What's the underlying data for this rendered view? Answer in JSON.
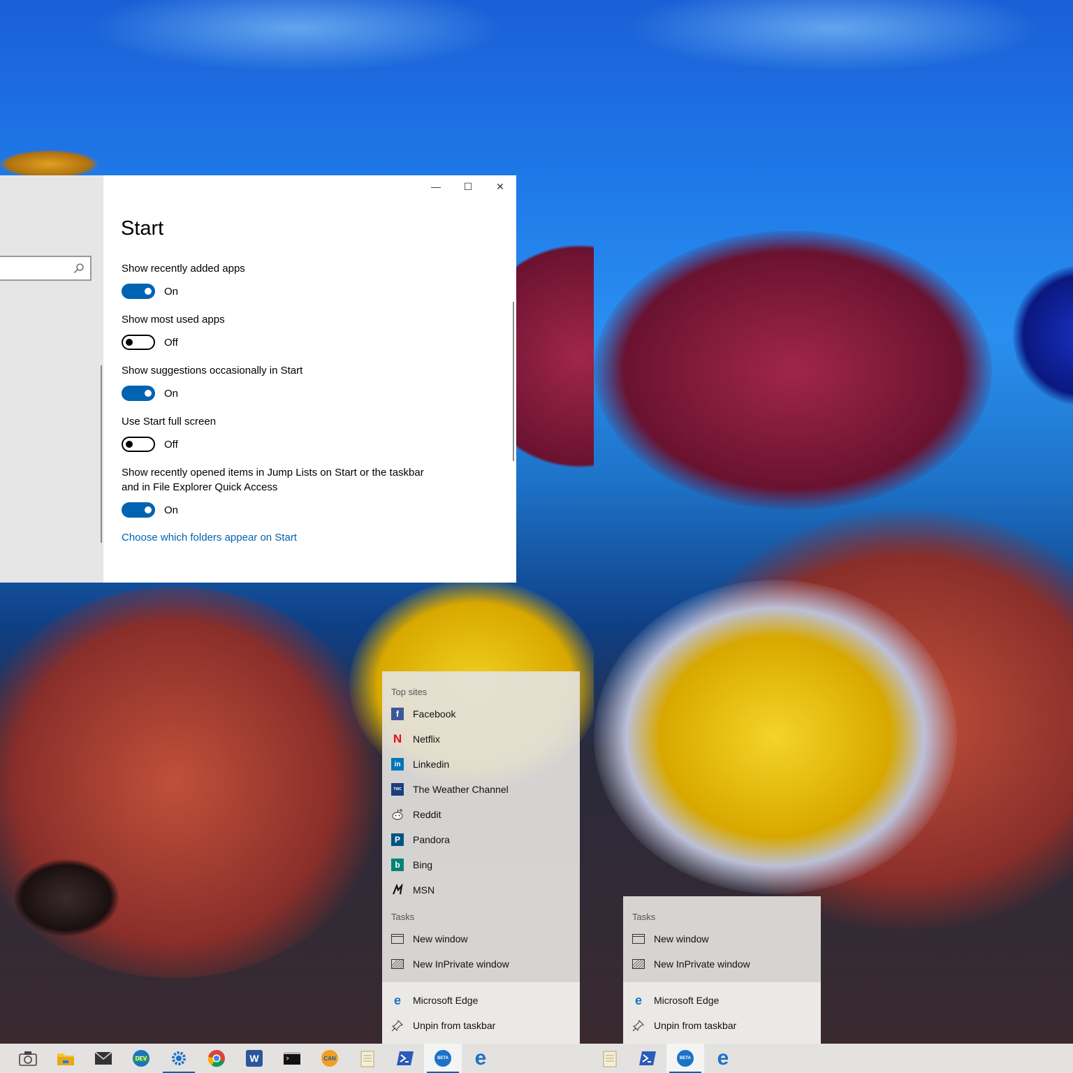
{
  "settings": {
    "title": "Start",
    "window_controls": {
      "minimize": "—",
      "maximize": "☐",
      "close": "✕"
    },
    "options": [
      {
        "label": "Show recently added apps",
        "state": "On"
      },
      {
        "label": "Show most used apps",
        "state": "Off"
      },
      {
        "label": "Show suggestions occasionally in Start",
        "state": "On"
      },
      {
        "label": "Use Start full screen",
        "state": "Off"
      },
      {
        "label": "Show recently opened items in Jump Lists on Start or the taskbar",
        "label2": "and in File Explorer Quick Access",
        "state": "On"
      }
    ],
    "link": "Choose which folders appear on Start"
  },
  "jumplist_left": {
    "top_sites_header": "Top sites",
    "top_sites": [
      "Facebook",
      "Netflix",
      "Linkedin",
      "The Weather Channel",
      "Reddit",
      "Pandora",
      "Bing",
      "MSN"
    ],
    "tasks_header": "Tasks",
    "tasks": [
      "New window",
      "New InPrivate window"
    ],
    "footer": [
      "Microsoft Edge",
      "Unpin from taskbar"
    ]
  },
  "jumplist_right": {
    "tasks_header": "Tasks",
    "tasks": [
      "New window",
      "New InPrivate window"
    ],
    "footer": [
      "Microsoft Edge",
      "Unpin from taskbar"
    ]
  },
  "taskbar": {
    "edge_dev_badge": "DEV",
    "edge_canary_badge": "CAN",
    "edge_beta_badge": "BETA",
    "word_letter": "W"
  },
  "colors": {
    "accent": "#0063b1",
    "facebook": "#3b5998",
    "netflix": "#e50914",
    "linkedin": "#0077b5",
    "pandora": "#005483",
    "bing": "#008373"
  }
}
